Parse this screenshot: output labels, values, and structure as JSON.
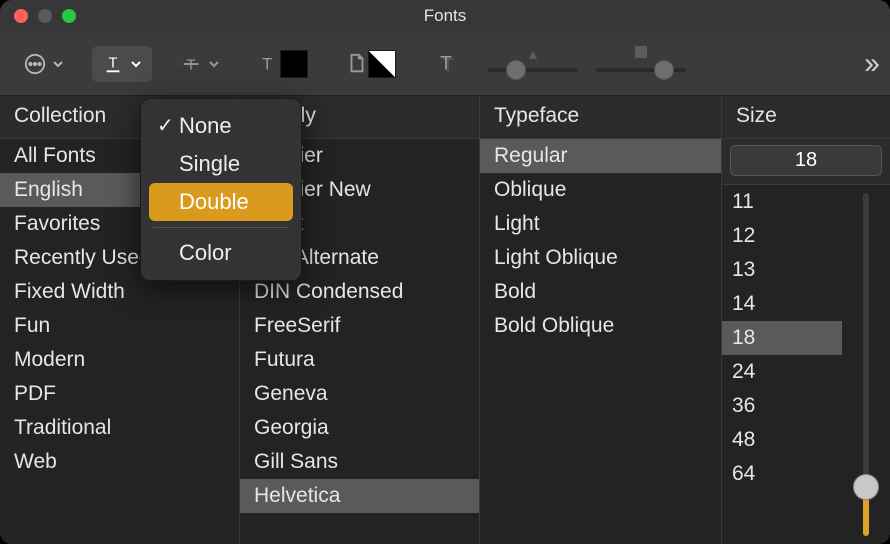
{
  "window": {
    "title": "Fonts"
  },
  "toolbar": {
    "underline_menu": {
      "items": [
        "None",
        "Single",
        "Double"
      ],
      "checked": "None",
      "highlighted": "Double",
      "color_item": "Color"
    }
  },
  "columns": {
    "collection": {
      "header": "Collection",
      "selected": "English",
      "items": [
        "All Fonts",
        "English",
        "Favorites",
        "Recently Used",
        "Fixed Width",
        "Fun",
        "Modern",
        "PDF",
        "Traditional",
        "Web"
      ]
    },
    "family": {
      "header": "Family",
      "selected": "Helvetica",
      "items": [
        "Courier",
        "Courier New",
        "Didot",
        "DIN Alternate",
        "DIN Condensed",
        "FreeSerif",
        "Futura",
        "Geneva",
        "Georgia",
        "Gill Sans",
        "Helvetica"
      ]
    },
    "typeface": {
      "header": "Typeface",
      "selected": "Regular",
      "items": [
        "Regular",
        "Oblique",
        "Light",
        "Light Oblique",
        "Bold",
        "Bold Oblique"
      ]
    },
    "size": {
      "header": "Size",
      "value": "18",
      "items": [
        "11",
        "12",
        "13",
        "14",
        "18",
        "24",
        "36",
        "48",
        "64"
      ]
    }
  }
}
